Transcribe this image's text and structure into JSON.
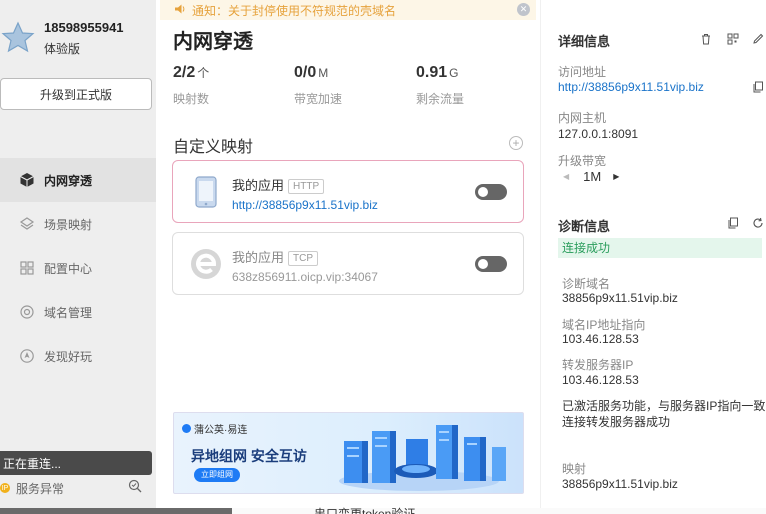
{
  "user": {
    "phone": "18598955941",
    "level": "体验版"
  },
  "sidebar": {
    "upgrade_label": "升级到正式版",
    "items": [
      {
        "label": "内网穿透",
        "icon": "cube-icon",
        "active": true
      },
      {
        "label": "场景映射",
        "icon": "layers-icon",
        "active": false
      },
      {
        "label": "配置中心",
        "icon": "grid-icon",
        "active": false
      },
      {
        "label": "域名管理",
        "icon": "globe-gear-icon",
        "active": false
      },
      {
        "label": "发现好玩",
        "icon": "compass-icon",
        "active": false
      }
    ],
    "toast": "正在重连...",
    "service_status": "服务异常",
    "service_badge": "IP"
  },
  "notice": {
    "text": "通知：关于封停使用不符规范的壳域名"
  },
  "main": {
    "title": "内网穿透",
    "stats": [
      {
        "value": "2/2",
        "unit": "个",
        "label": "映射数"
      },
      {
        "value": "0/0",
        "unit": "M",
        "label": "带宽加速"
      },
      {
        "value": "0.91",
        "unit": "G",
        "label": "剩余流量"
      }
    ],
    "section_title": "自定义映射",
    "add_symbol": "+",
    "mappings": [
      {
        "name": "我的应用",
        "protocol": "HTTP",
        "url": "http://38856p9x11.51vip.biz",
        "enabled": false
      },
      {
        "name": "我的应用",
        "protocol": "TCP",
        "url": "638z856911.oicp.vip:34067",
        "enabled": false
      }
    ],
    "banner": {
      "brand": "蒲公英·易连",
      "headline": "异地组网  安全互访",
      "cta": "立即组网"
    }
  },
  "details": {
    "title": "详细信息",
    "access_label": "访问地址",
    "access_url": "http://38856p9x11.51vip.biz",
    "host_label": "内网主机",
    "host_value": "127.0.0.1:8091",
    "bandwidth_label": "升级带宽",
    "bandwidth_value": "1M"
  },
  "diagnosis": {
    "title": "诊断信息",
    "status": "连接成功",
    "domain_label": "诊断域名",
    "domain_value": "38856p9x11.51vip.biz",
    "ip_label": "域名IP地址指向",
    "ip_value": "103.46.128.53",
    "server_label": "转发服务器IP",
    "server_value": "103.46.128.53",
    "note": "已激活服务功能，与服务器IP指向一致连接转发服务器成功",
    "mapping_label": "映射",
    "mapping_value": "38856p9x11.51vip.biz"
  },
  "background": {
    "text": "串口变更token验证"
  },
  "colors": {
    "accent": "#1a73c9",
    "success": "#2a9d5c",
    "notice": "#e6a23c",
    "active_border": "#e9a5bb"
  }
}
